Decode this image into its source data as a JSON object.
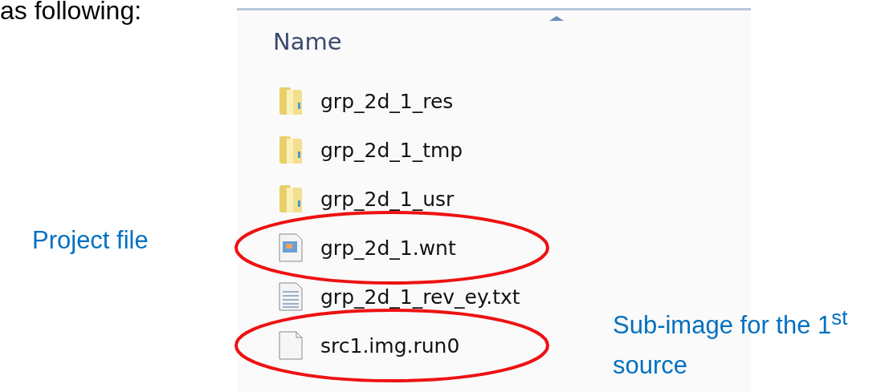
{
  "intro": "as following:",
  "explorer": {
    "column": "Name",
    "rows": [
      {
        "name": "grp_2d_1_res",
        "kind": "folder",
        "circled": false
      },
      {
        "name": "grp_2d_1_tmp",
        "kind": "folder",
        "circled": false
      },
      {
        "name": "grp_2d_1_usr",
        "kind": "folder",
        "circled": false
      },
      {
        "name": "grp_2d_1.wnt",
        "kind": "image",
        "circled": true
      },
      {
        "name": "grp_2d_1_rev_ey.txt",
        "kind": "text",
        "circled": false
      },
      {
        "name": "src1.img.run0",
        "kind": "file",
        "circled": true
      }
    ]
  },
  "project_label": "Project file",
  "sub_image_label": "Sub-image for the 1$^{st}$ source"
}
